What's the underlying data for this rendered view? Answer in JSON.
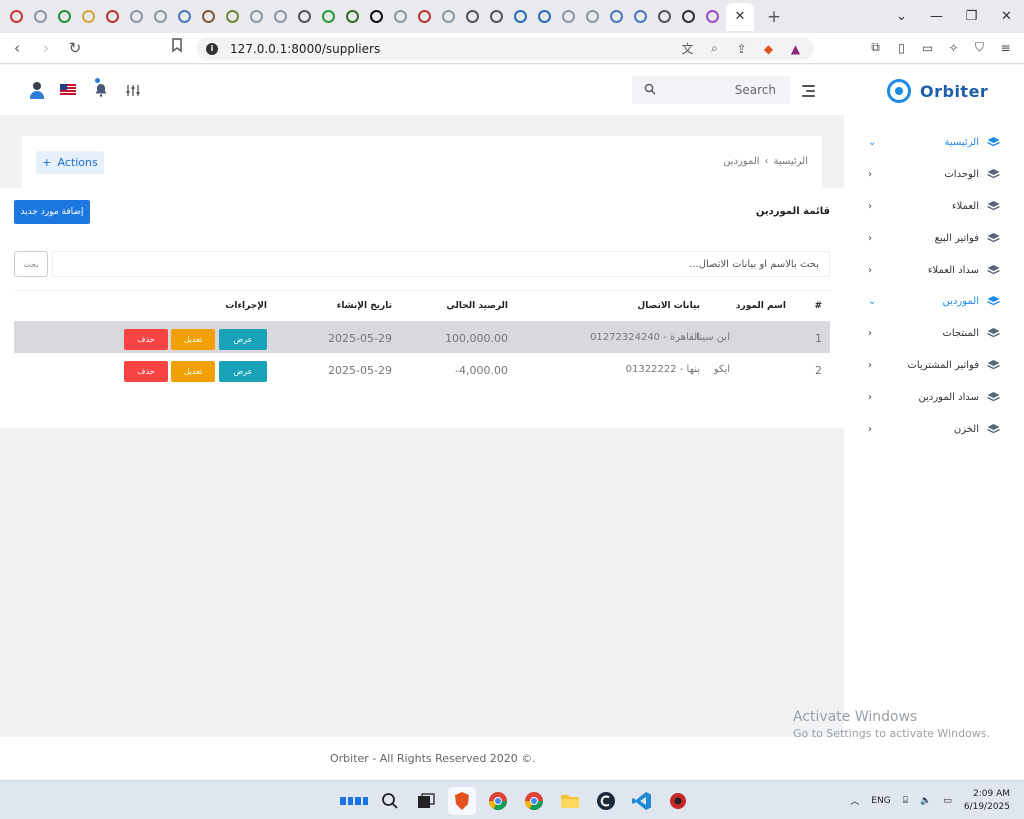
{
  "browser": {
    "url": "127.0.0.1:8000/suppliers",
    "active_tab_close": "✕",
    "new_tab": "+"
  },
  "header": {
    "search_placeholder": "Search",
    "brand": "Orbiter"
  },
  "sidebar": {
    "items": [
      {
        "label": "الرئيسية",
        "active": true,
        "open": true
      },
      {
        "label": "الوحدات",
        "active": false,
        "open": false
      },
      {
        "label": "العملاء",
        "active": false,
        "open": false
      },
      {
        "label": "فواتير البيع",
        "active": false,
        "open": false
      },
      {
        "label": "سداد العملاء",
        "active": false,
        "open": false
      },
      {
        "label": "الموردين",
        "active": true,
        "open": true
      },
      {
        "label": "المنتجات",
        "active": false,
        "open": false
      },
      {
        "label": "فواتير المشتريات",
        "active": false,
        "open": false
      },
      {
        "label": "سداد الموردين",
        "active": false,
        "open": false
      },
      {
        "label": "الخزن",
        "active": false,
        "open": false
      }
    ]
  },
  "breadcrumb": {
    "home": "الرئيسية",
    "separator": "›",
    "current": "الموردين",
    "actions_label": "Actions",
    "actions_plus": "+"
  },
  "page": {
    "title": "قائمة الموردين",
    "add_button": "إضافة مورد جديد",
    "filter_placeholder": "بحث بالاسم أو بيانات الاتصال...",
    "filter_button": "بحث"
  },
  "table": {
    "headers": {
      "index": "#",
      "name": "اسم المورد",
      "contact": "بيانات الاتصال",
      "balance": "الرصيد الحالي",
      "created": "تاريخ الإنشاء",
      "actions": "الإجراءات"
    },
    "rows": [
      {
        "index": "1",
        "name": "ابن سينا",
        "contact_city": "القاهرة -",
        "contact_phone": "01272324240",
        "balance": "100,000.00",
        "created": "2025-05-29"
      },
      {
        "index": "2",
        "name": "ايكو",
        "contact_city": "بنها -",
        "contact_phone": "01322222",
        "balance": "-4,000.00",
        "created": "2025-05-29"
      }
    ],
    "buttons": {
      "view": "عرض",
      "edit": "تعديل",
      "delete": "حذف"
    }
  },
  "footer": {
    "text": "Orbiter - All Rights Reserved 2020 ©."
  },
  "watermark": {
    "line1": "Activate Windows",
    "line2": "Go to Settings to activate Windows."
  },
  "taskbar": {
    "lang": "ENG",
    "time": "2:09 AM",
    "date": "6/19/2025"
  },
  "colors": {
    "primary": "#1d77e0",
    "info": "#17a2b8",
    "warning": "#f0a000",
    "danger": "#fa4343",
    "brand": "#1d8ae8"
  }
}
